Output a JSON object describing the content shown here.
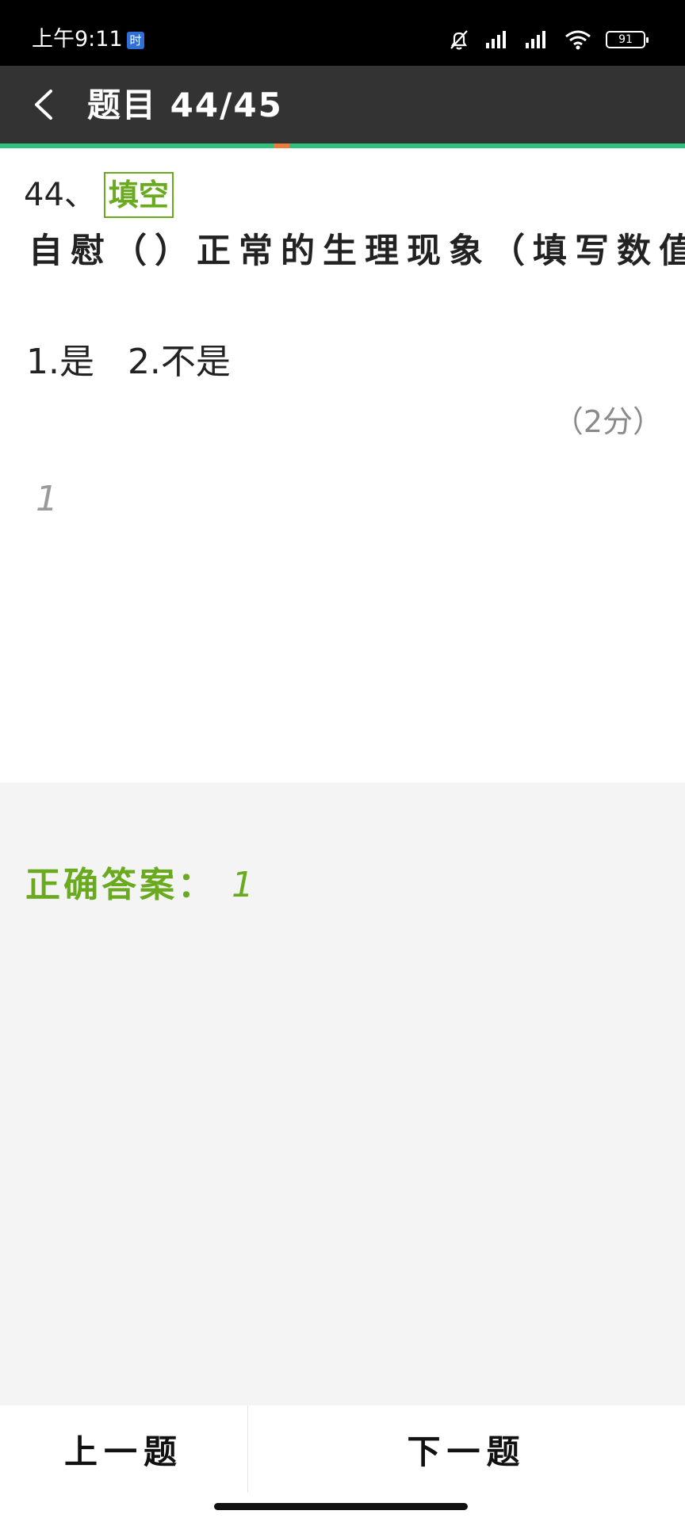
{
  "status_bar": {
    "time": "上午9:11",
    "badge": "时",
    "battery": "91",
    "icons": [
      "mute-bell-icon",
      "signal-icon",
      "signal-icon",
      "wifi-icon",
      "battery-icon"
    ]
  },
  "app_bar": {
    "title": "题目 44/45",
    "back_icon": "chevron-left-icon"
  },
  "progress": {
    "current": 44,
    "total": 45
  },
  "question": {
    "number": "44、",
    "type": "填空",
    "text": "自慰（）正常的生理现象（填写数值",
    "options": "1.是   2.不是",
    "score": "（2分）",
    "user_answer": "1"
  },
  "answer": {
    "label": "正确答案：",
    "value": "1"
  },
  "nav": {
    "prev": "上一题",
    "next": "下一题"
  },
  "colors": {
    "accent_green": "#6aaa1e",
    "progress_green": "#2ec27e",
    "progress_marker": "#ee7a3c",
    "app_bar": "#333333"
  }
}
